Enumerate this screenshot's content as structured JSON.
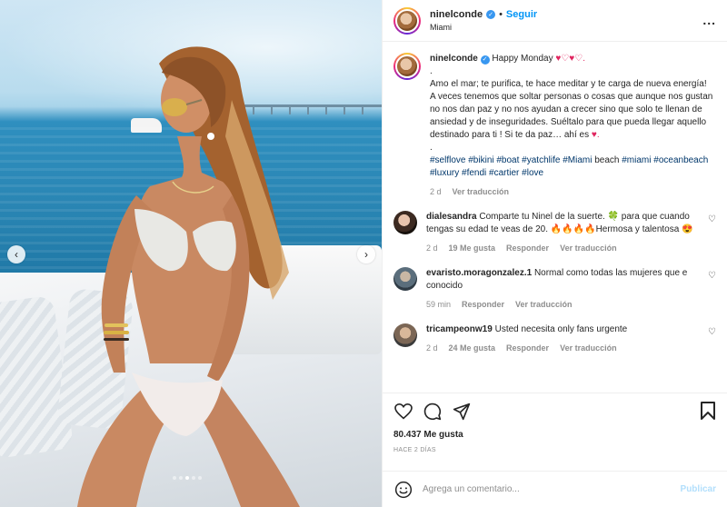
{
  "header": {
    "username": "ninelconde",
    "separator": "•",
    "follow_label": "Seguir",
    "location": "Miami",
    "more_label": "..."
  },
  "carousel": {
    "prev_label": "‹",
    "next_label": "›",
    "total_slides": 5,
    "active_slide": 3
  },
  "caption": {
    "username": "ninelconde",
    "title": "Happy Monday",
    "title_hearts": "♥♡♥♡.",
    "dot1": ".",
    "line1": "Amo el mar; te purifica, te hace meditar y te carga de nueva energía!",
    "line2": "A veces tenemos que soltar personas o cosas que aunque nos gustan no nos dan paz y no nos ayudan a crecer sino que solo te llenan de ansiedad y de inseguridades. Suéltalo para que pueda llegar aquello destinado para ti ! Si te da paz… ahí es",
    "line2_heart": "♥.",
    "dot2": ".",
    "tags_1": "#selflove #bikini #boat #yatchlife #Miami",
    "tags_plain": "beach",
    "tags_2": "#miami #oceanbeach #luxury #fendi #cartier #love",
    "time": "2 d",
    "translate": "Ver traducción"
  },
  "comments": [
    {
      "username": "dialesandra",
      "text": "Comparte tu Ninel de la suerte. 🍀 para que cuando tengas su edad te veas de 20. 🔥🔥🔥🔥Hermosa y talentosa 😍",
      "time": "2 d",
      "likes": "19 Me gusta",
      "reply": "Responder",
      "translate": "Ver traducción",
      "heart": "♡"
    },
    {
      "username": "evaristo.moragonzalez.1",
      "text": "Normal como todas las mujeres que e conocido",
      "time": "59 min",
      "likes": "",
      "reply": "Responder",
      "translate": "Ver traducción",
      "heart": "♡"
    },
    {
      "username": "tricampeonw19",
      "text": "Usted necesita only fans urgente",
      "time": "2 d",
      "likes": "24 Me gusta",
      "reply": "Responder",
      "translate": "Ver traducción",
      "heart": "♡"
    }
  ],
  "actions": {
    "likes": "80.437 Me gusta",
    "ago": "HACE 2 DÍAS"
  },
  "add_comment": {
    "placeholder": "Agrega un comentario...",
    "publish_label": "Publicar"
  },
  "colors": {
    "accent": "#0095f6",
    "link": "#00376b",
    "heart": "#e0245e",
    "publish_disabled": "#b2dffc"
  }
}
